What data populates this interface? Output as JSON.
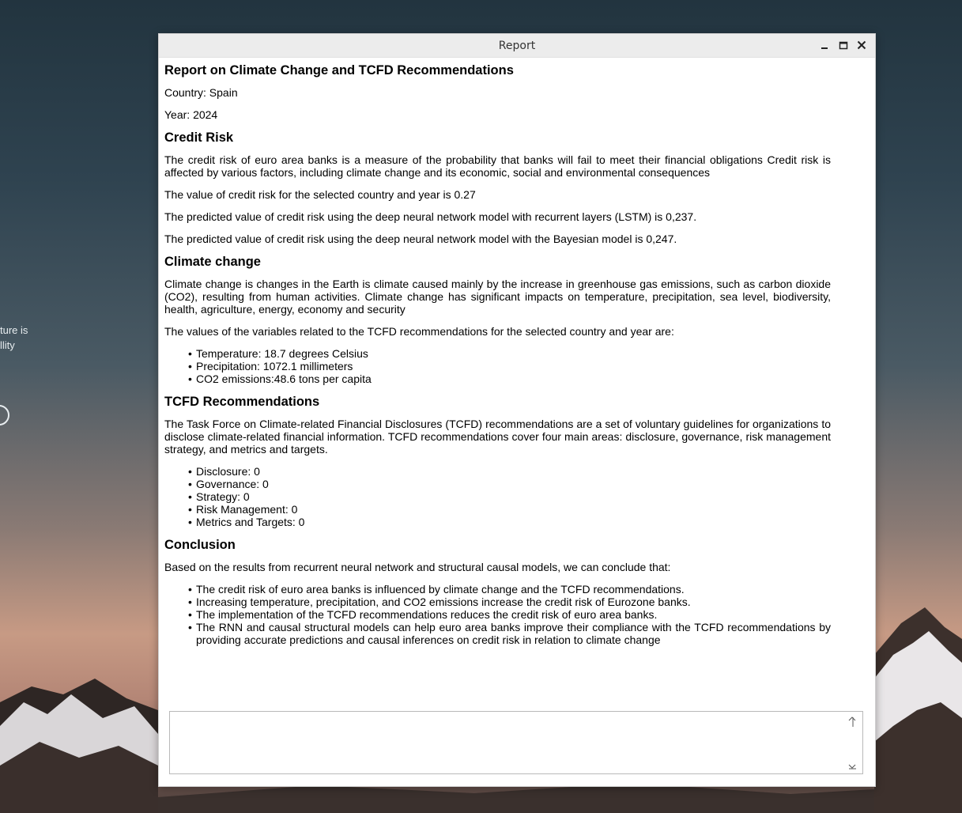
{
  "desktop": {
    "side_text_line1": "ture is",
    "side_text_line2": "llity"
  },
  "window": {
    "title": "Report",
    "controls": [
      "minimize-icon",
      "maximize-icon",
      "close-icon"
    ]
  },
  "report": {
    "title": "Report on Climate Change and TCFD Recommendations",
    "country": "Country: Spain",
    "year": "Year: 2024",
    "credit_risk": {
      "heading": "Credit Risk",
      "intro": "The credit risk of euro area banks is a measure of the probability that banks will fail to meet their financial obligations Credit risk is affected by various factors, including climate change and its economic, social and environmental consequences",
      "value": "The value of credit risk for the selected country and year is 0.27",
      "lstm": "The predicted value of credit risk using the deep neural network model with recurrent layers (LSTM) is 0,237.",
      "bayesian": "The predicted value of credit risk using the deep neural network model with the Bayesian model is 0,247."
    },
    "climate": {
      "heading": "Climate change",
      "intro": "Climate change is changes in the Earth is climate caused mainly by the increase in greenhouse gas emissions, such as carbon dioxide (CO2), resulting from human activities. Climate change has significant impacts on temperature, precipitation, sea level, biodiversity, health, agriculture, energy, economy and security",
      "lead": "The values of the variables related to the TCFD recommendations for the selected country and year are:",
      "items": [
        "Temperature: 18.7 degrees Celsius",
        "Precipitation: 1072.1 millimeters",
        "CO2 emissions:48.6 tons per capita"
      ]
    },
    "tcfd": {
      "heading": "TCFD Recommendations",
      "intro": "The Task Force on Climate-related Financial Disclosures (TCFD) recommendations are a set of voluntary guidelines for organizations to disclose climate-related financial information. TCFD recommendations cover four main areas: disclosure, governance, risk management strategy, and metrics and targets.",
      "items": [
        "Disclosure: 0",
        "Governance: 0",
        "Strategy: 0",
        "Risk Management: 0",
        "Metrics and Targets: 0"
      ]
    },
    "conclusion": {
      "heading": "Conclusion",
      "lead": "Based on the results from recurrent neural network and structural causal models, we can conclude that:",
      "items": [
        "The credit risk of euro area banks is influenced by climate change and the TCFD recommendations.",
        "Increasing temperature, precipitation, and CO2 emissions increase the credit risk of Eurozone banks.",
        "The implementation of the TCFD recommendations reduces the credit risk of euro area banks.",
        "The RNN and causal structural models can help euro area banks improve their compliance with the TCFD recommendations by providing accurate predictions and causal inferences on credit risk in relation to climate change"
      ]
    }
  },
  "input": {
    "value": ""
  }
}
